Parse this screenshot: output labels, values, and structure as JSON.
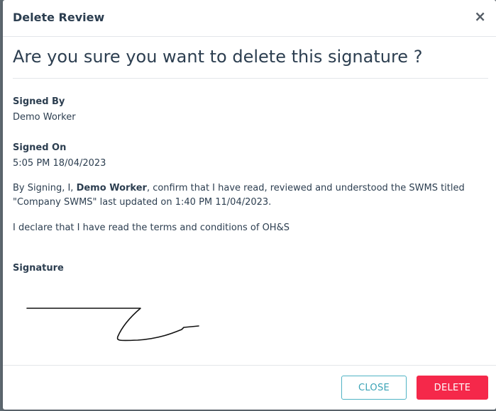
{
  "dialog": {
    "title": "Delete Review",
    "close_icon": "close-icon"
  },
  "question": "Are you sure you want to delete this signature ?",
  "signed_by": {
    "label": "Signed By",
    "value": "Demo Worker"
  },
  "signed_on": {
    "label": "Signed On",
    "value": "5:05 PM 18/04/2023"
  },
  "confirmation": {
    "prefix": "By Signing, I, ",
    "name": "Demo Worker",
    "suffix": ", confirm that I have read, reviewed and understood the SWMS titled \"Company SWMS\" last updated on 1:40 PM 11/04/2023."
  },
  "declaration": "I declare that I have read the terms and conditions of OH&S",
  "signature": {
    "label": "Signature"
  },
  "buttons": {
    "close": "CLOSE",
    "delete": "DELETE"
  },
  "colors": {
    "close_button": "#3aa3b6",
    "delete_button": "#f5284a",
    "text": "#2c3e50"
  }
}
